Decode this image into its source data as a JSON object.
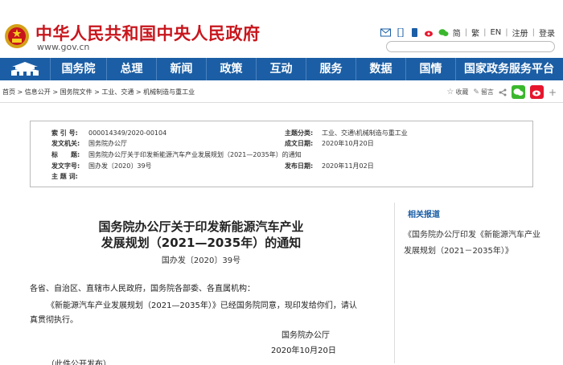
{
  "header": {
    "site_title": "中华人民共和国中央人民政府",
    "site_url": "www.gov.cn",
    "top_links": [
      "简",
      "繁",
      "EN",
      "注册",
      "登录"
    ],
    "icons": [
      "mail-icon",
      "mobile-icon",
      "phone-icon",
      "weibo-icon",
      "wechat-icon"
    ],
    "search_placeholder": ""
  },
  "nav": {
    "items": [
      "国务院",
      "总理",
      "新闻",
      "政策",
      "互动",
      "服务",
      "数据",
      "国情",
      "国家政务服务平台"
    ]
  },
  "breadcrumb": {
    "text": "首页 > 信息公开 > 国务院文件 > 工业、交通 > 机械制造与重工业"
  },
  "tools": {
    "favorite": "收藏",
    "comment": "留言",
    "plus": "+"
  },
  "meta": {
    "index_label": "索 引 号:",
    "index_value": "000014349/2020-00104",
    "topic_label": "主题分类:",
    "topic_value": "工业、交通\\机械制造与重工业",
    "issuer_label": "发文机关:",
    "issuer_value": "国务院办公厅",
    "date_label": "成文日期:",
    "date_value": "2020年10月20日",
    "title_label": "标　　题:",
    "title_value": "国务院办公厅关于印发新能源汽车产业发展规划（2021—2035年）的通知",
    "docno_label": "发文字号:",
    "docno_value": "国办发〔2020〕39号",
    "pub_label": "发布日期:",
    "pub_value": "2020年11月02日",
    "keywords_label": "主 题 词:",
    "keywords_value": ""
  },
  "article": {
    "title_line1": "国务院办公厅关于印发新能源汽车产业",
    "title_line2": "发展规划（2021—2035年）的通知",
    "doc_no": "国办发〔2020〕39号",
    "salutation": "各省、自治区、直辖市人民政府，国务院各部委、各直属机构：",
    "para1_line1": "《新能源汽车产业发展规划（2021—2035年）》已经国务院同意，现印发给你们，请认",
    "para1_line2": "真贯彻执行。",
    "signature": "国务院办公厅",
    "sign_date": "2020年10月20日",
    "note": "（此件公开发布）"
  },
  "related": {
    "title": "相关报道",
    "items": [
      "《国务院办公厅印发《新能源汽车产业发展规划（2021－2035年）》"
    ]
  },
  "colors": {
    "brand_red": "#c8161d",
    "nav_blue": "#1b5ea5"
  }
}
